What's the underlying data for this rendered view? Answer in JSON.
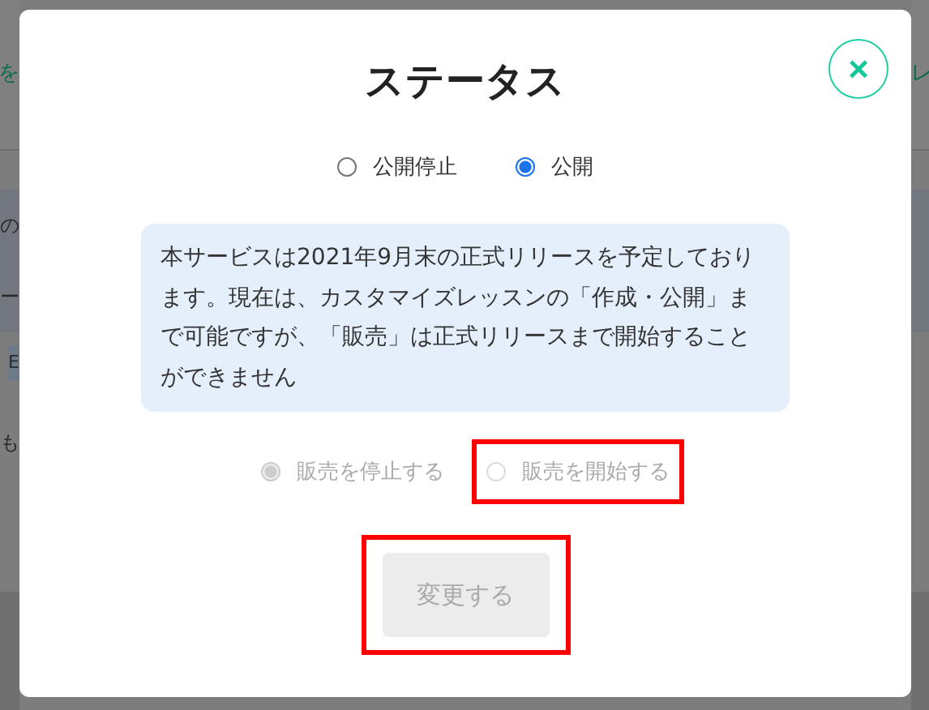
{
  "background": {
    "left_fragments": [
      {
        "text": "を",
        "kind": "button"
      },
      {
        "text": "の",
        "kind": "plain"
      },
      {
        "text": "ー",
        "kind": "plain"
      },
      {
        "text": "E",
        "kind": "tag"
      },
      {
        "text": "も",
        "kind": "plain"
      }
    ],
    "right_fragments": [
      {
        "text": "レ",
        "kind": "button"
      }
    ]
  },
  "dialog": {
    "title": "ステータス",
    "close_label": "×",
    "visibility": [
      {
        "label": "公開停止",
        "selected": false
      },
      {
        "label": "公開",
        "selected": true
      }
    ],
    "notice": "本サービスは2021年9月末の正式リリースを予定しております。現在は、カスタマイズレッスンの「作成・公開」まで可能ですが、「販売」は正式リリースまで開始することができません",
    "sales": [
      {
        "label": "販売を停止する",
        "selected": true,
        "disabled": true,
        "highlighted": false
      },
      {
        "label": "販売を開始する",
        "selected": false,
        "disabled": true,
        "highlighted": true
      }
    ],
    "submit": {
      "label": "変更する",
      "disabled": true,
      "highlighted": true
    }
  }
}
